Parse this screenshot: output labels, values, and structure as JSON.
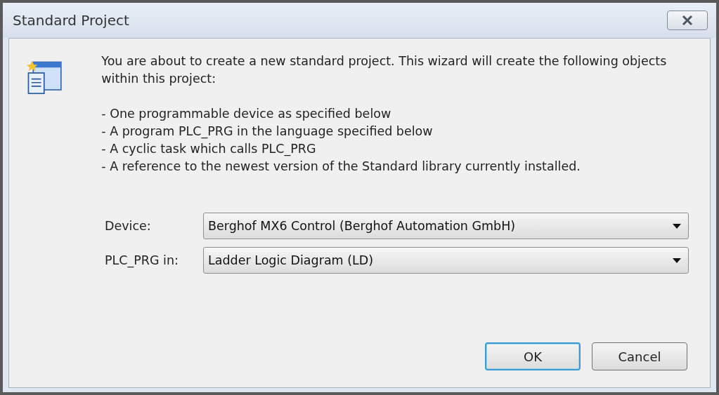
{
  "window": {
    "title": "Standard Project"
  },
  "intro": "You are about to create a new standard project. This wizard will create the following objects within this project:",
  "items": [
    "- One programmable device as specified below",
    "- A program PLC_PRG in the language specified below",
    "- A cyclic task which calls PLC_PRG",
    "- A reference to the newest version of the Standard library currently installed."
  ],
  "fields": [
    {
      "label": "Device:",
      "value": "Berghof MX6 Control (Berghof Automation GmbH)"
    },
    {
      "label": "PLC_PRG in:",
      "value": "Ladder Logic Diagram (LD)"
    }
  ],
  "buttons": [
    {
      "label": "OK",
      "default": true
    },
    {
      "label": "Cancel",
      "default": false
    }
  ]
}
